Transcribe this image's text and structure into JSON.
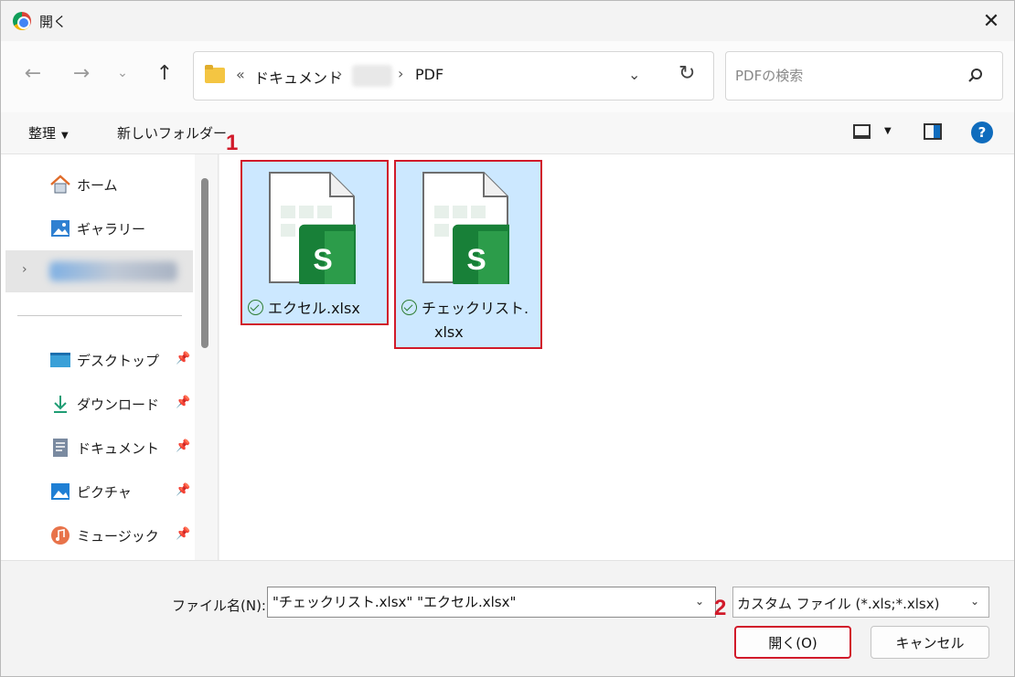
{
  "window": {
    "title": "開く"
  },
  "nav": {
    "back_icon": "arrow-left-icon",
    "forward_icon": "arrow-right-icon",
    "recent_icon": "chevron-down-icon",
    "up_icon": "arrow-up-icon"
  },
  "address": {
    "overflow": "«",
    "crumb1": "ドキュメント",
    "sep": "›",
    "crumb3": "PDF"
  },
  "search": {
    "placeholder": "PDFの検索"
  },
  "toolbar": {
    "organize": "整理",
    "new_folder": "新しいフォルダー"
  },
  "sidebar": {
    "items": [
      {
        "label": "ホーム",
        "icon": "home-icon"
      },
      {
        "label": "ギャラリー",
        "icon": "gallery-icon"
      },
      {
        "label": "デスクトップ",
        "icon": "desktop-icon",
        "pinned": true
      },
      {
        "label": "ダウンロード",
        "icon": "download-icon",
        "pinned": true
      },
      {
        "label": "ドキュメント",
        "icon": "documents-icon",
        "pinned": true
      },
      {
        "label": "ピクチャ",
        "icon": "pictures-icon",
        "pinned": true
      },
      {
        "label": "ミュージック",
        "icon": "music-icon",
        "pinned": true
      }
    ]
  },
  "files": [
    {
      "name": "エクセル.xlsx",
      "selected": true,
      "synced": true
    },
    {
      "name_line1": "チェックリスト.",
      "name_line2": "xlsx",
      "selected": true,
      "synced": true
    }
  ],
  "annotations": {
    "step1": "1",
    "step2": "2"
  },
  "bottom": {
    "filename_label": "ファイル名(N):",
    "filename_value": "\"チェックリスト.xlsx\" \"エクセル.xlsx\"",
    "filetype": "カスタム ファイル (*.xls;*.xlsx)",
    "open_button": "開く(O)",
    "cancel_button": "キャンセル"
  },
  "colors": {
    "accent": "#0f6cbd",
    "selection": "#cce8ff",
    "annotation": "#d11a2a",
    "sheets_green": "#188038"
  }
}
